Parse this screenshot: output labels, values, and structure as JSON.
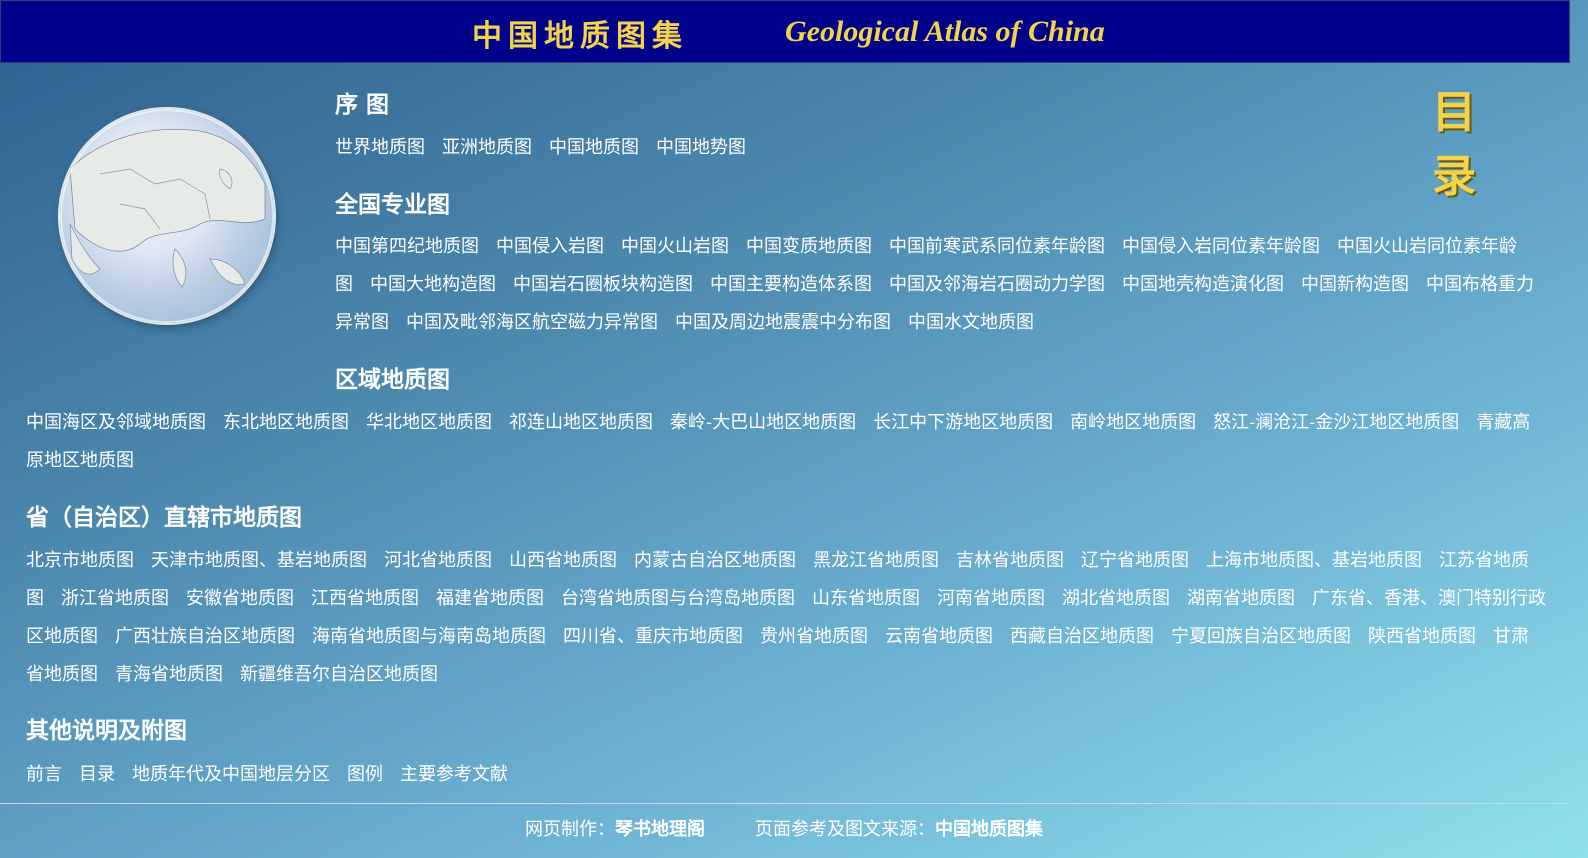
{
  "header": {
    "title_cn": "中国地质图集",
    "title_en": "Geological Atlas of China"
  },
  "toc_heading": "目 录",
  "globe": {
    "icon": "globe-map-icon"
  },
  "sections": [
    {
      "title": "序  图",
      "links": [
        "世界地质图",
        "亚洲地质图",
        "中国地质图",
        "中国地势图"
      ]
    },
    {
      "title": "全国专业图",
      "links": [
        "中国第四纪地质图",
        "中国侵入岩图",
        "中国火山岩图",
        "中国变质地质图",
        "中国前寒武系同位素年龄图",
        "中国侵入岩同位素年龄图",
        "中国火山岩同位素年龄图",
        "中国大地构造图",
        "中国岩石圈板块构造图",
        "中国主要构造体系图",
        "中国及邻海岩石圈动力学图",
        "中国地壳构造演化图",
        "中国新构造图",
        "中国布格重力异常图",
        "中国及毗邻海区航空磁力异常图",
        "中国及周边地震震中分布图",
        "中国水文地质图"
      ]
    },
    {
      "title": "区域地质图",
      "links": [
        "中国海区及邻域地质图",
        "东北地区地质图",
        "华北地区地质图",
        "祁连山地区地质图",
        "秦岭-大巴山地区地质图",
        "长江中下游地区地质图",
        "南岭地区地质图",
        "怒江-澜沧江-金沙江地区地质图",
        "青藏高原地区地质图"
      ]
    },
    {
      "title": "省（自治区）直辖市地质图",
      "links": [
        "北京市地质图",
        "天津市地质图、基岩地质图",
        "河北省地质图",
        "山西省地质图",
        "内蒙古自治区地质图",
        "黑龙江省地质图",
        "吉林省地质图",
        "辽宁省地质图",
        "上海市地质图、基岩地质图",
        "江苏省地质图",
        "浙江省地质图",
        "安徽省地质图",
        "江西省地质图",
        "福建省地质图",
        "台湾省地质图与台湾岛地质图",
        "山东省地质图",
        "河南省地质图",
        "湖北省地质图",
        "湖南省地质图",
        "广东省、香港、澳门特别行政区地质图",
        "广西壮族自治区地质图",
        "海南省地质图与海南岛地质图",
        "四川省、重庆市地质图",
        "贵州省地质图",
        "云南省地质图",
        "西藏自治区地质图",
        "宁夏回族自治区地质图",
        "陕西省地质图",
        "甘肃省地质图",
        "青海省地质图",
        "新疆维吾尔自治区地质图"
      ]
    },
    {
      "title": "其他说明及附图",
      "links": [
        "前言",
        "目录",
        "地质年代及中国地层分区",
        "图例",
        "主要参考文献"
      ]
    }
  ],
  "footer": {
    "made_label": "网页制作：",
    "made_value": "琴书地理阁",
    "source_label": "页面参考及图文来源：",
    "source_value": "中国地质图集"
  }
}
